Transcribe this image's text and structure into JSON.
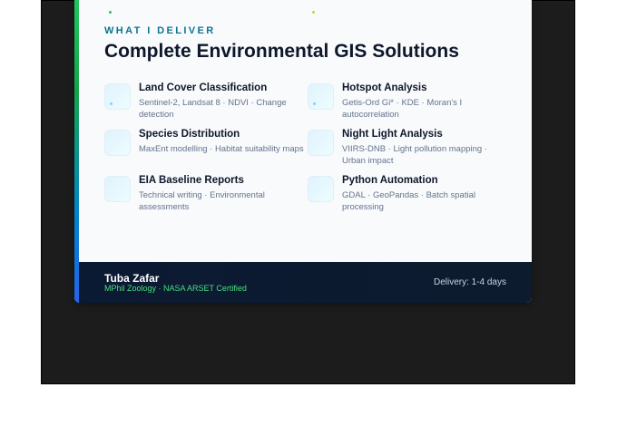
{
  "colors": {
    "frame_bg": "#1c1c1c",
    "card_bg": "#f8fafc",
    "eyebrow": "#0e7490",
    "title": "#0f172a",
    "footer_bg": "#0b1a33",
    "credentials": "#4ade80",
    "accent_gradient_top": "#22c55e",
    "accent_gradient_bottom": "#2563eb"
  },
  "header": {
    "eyebrow": "WHAT I DELIVER",
    "title": "Complete Environmental GIS Solutions"
  },
  "services": [
    {
      "name": "Land Cover Classification",
      "desc": "Sentinel-2, Landsat 8 · NDVI · Change detection",
      "icon": "satellite-layers-icon"
    },
    {
      "name": "Hotspot Analysis",
      "desc": "Getis-Ord Gi* · KDE · Moran's I autocorrelation",
      "icon": "hotspot-icon"
    },
    {
      "name": "Species Distribution",
      "desc": "MaxEnt modelling · Habitat suitability maps",
      "icon": "species-icon"
    },
    {
      "name": "Night Light Analysis",
      "desc": "VIIRS-DNB · Light pollution mapping · Urban impact",
      "icon": "night-light-icon"
    },
    {
      "name": "EIA Baseline Reports",
      "desc": "Technical writing · Environmental assessments",
      "icon": "report-icon"
    },
    {
      "name": "Python Automation",
      "desc": "GDAL · GeoPandas · Batch spatial processing",
      "icon": "python-icon"
    }
  ],
  "footer": {
    "author": "Tuba Zafar",
    "credentials": "MPhil Zoology · NASA ARSET Certified",
    "delivery": "Delivery: 1-4 days"
  }
}
